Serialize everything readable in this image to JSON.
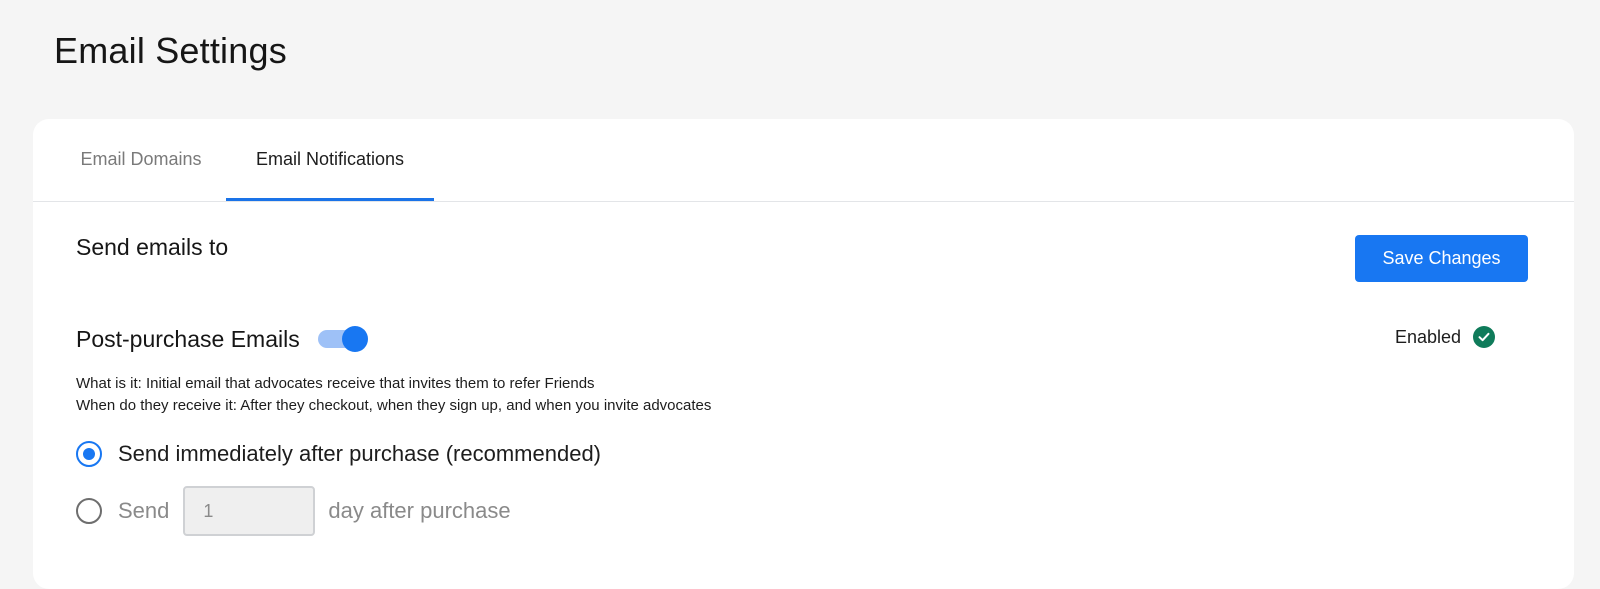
{
  "page": {
    "title": "Email Settings"
  },
  "tabs": [
    {
      "label": "Email Domains",
      "active": false
    },
    {
      "label": "Email Notifications",
      "active": true
    }
  ],
  "section": {
    "title": "Send emails to",
    "save_label": "Save Changes"
  },
  "post_purchase": {
    "label": "Post-purchase Emails",
    "toggle_on": true,
    "status_label": "Enabled",
    "description": {
      "what": "What is it: Initial email that advocates receive that invites them to refer Friends",
      "when": "When do they receive it: After they checkout, when they sign up, and when you invite advocates"
    },
    "options": [
      {
        "label": "Send immediately after purchase (recommended)",
        "selected": true
      },
      {
        "prefix": "Send",
        "value": "1",
        "suffix": "day after purchase",
        "selected": false
      }
    ]
  },
  "colors": {
    "accent": "#1877f2",
    "success": "#0f7b5a",
    "background": "#f5f5f5"
  },
  "icons": {
    "status": "check-circle-icon"
  }
}
